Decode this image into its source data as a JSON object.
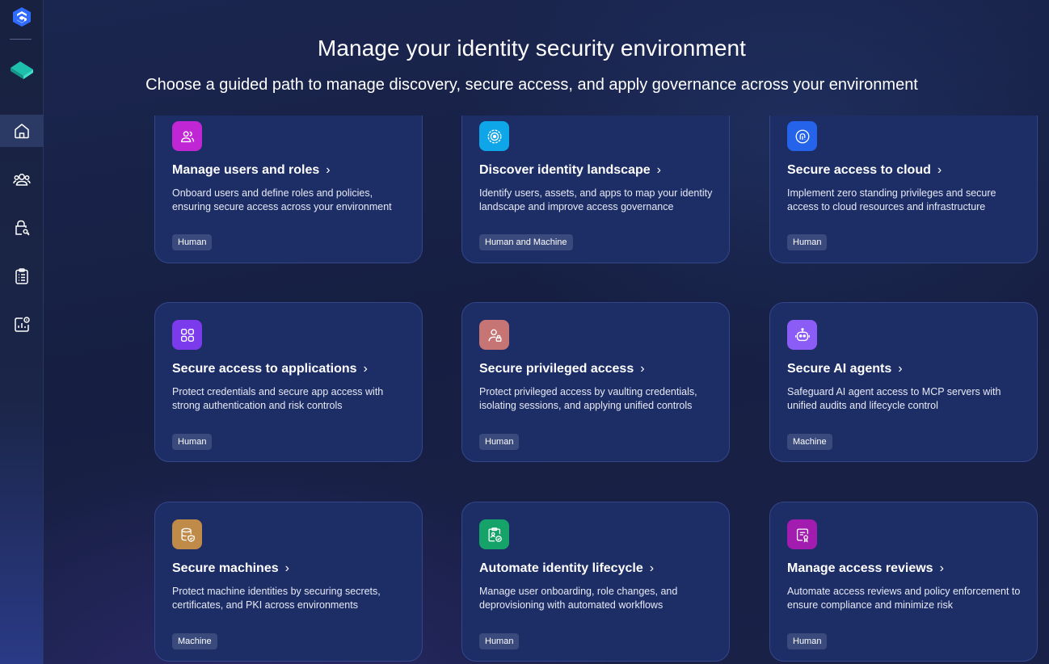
{
  "header": {
    "title": "Manage your identity security environment",
    "subtitle": "Choose a guided path to manage discovery, secure access, and apply governance across your environment"
  },
  "sidebar": {
    "items": [
      {
        "name": "home",
        "icon": "home-icon",
        "active": true
      },
      {
        "name": "users",
        "icon": "users-icon",
        "active": false
      },
      {
        "name": "access",
        "icon": "lock-key-icon",
        "active": false
      },
      {
        "name": "reports",
        "icon": "clipboard-list-icon",
        "active": false
      },
      {
        "name": "analytics",
        "icon": "analytics-icon",
        "active": false
      }
    ]
  },
  "cards": [
    {
      "title": "Manage users and roles",
      "description": "Onboard users and define roles and policies, ensuring secure access across your environment",
      "tag": "Human",
      "icon": "users-icon",
      "icon_color": "#c026d3"
    },
    {
      "title": "Discover identity landscape",
      "description": "Identify users, assets, and apps to map your identity landscape and improve access governance",
      "tag": "Human and Machine",
      "icon": "target-icon",
      "icon_color": "#0ea5e9"
    },
    {
      "title": "Secure access to cloud",
      "description": "Implement zero standing privileges and secure access to cloud resources and infrastructure",
      "tag": "Human",
      "icon": "fingerprint-icon",
      "icon_color": "#2563eb"
    },
    {
      "title": "Secure access to applications",
      "description": "Protect credentials and secure app access with strong authentication and risk controls",
      "tag": "Human",
      "icon": "apps-grid-icon",
      "icon_color": "#7c3aed"
    },
    {
      "title": "Secure privileged access",
      "description": "Protect privileged access by vaulting credentials, isolating sessions, and applying unified controls",
      "tag": "Human",
      "icon": "user-lock-icon",
      "icon_color": "#c67474"
    },
    {
      "title": "Secure AI agents",
      "description": "Safeguard AI agent access to MCP servers with unified audits and lifecycle control",
      "tag": "Machine",
      "icon": "robot-icon",
      "icon_color": "#8b5cf6"
    },
    {
      "title": "Secure machines",
      "description": "Protect machine identities by securing secrets, certificates, and PKI across environments",
      "tag": "Machine",
      "icon": "database-shield-icon",
      "icon_color": "#c08a48"
    },
    {
      "title": "Automate identity lifecycle",
      "description": "Manage user onboarding, role changes, and deprovisioning with automated workflows",
      "tag": "Human",
      "icon": "clipboard-check-icon",
      "icon_color": "#16a36a"
    },
    {
      "title": "Manage access reviews",
      "description": "Automate access reviews and policy enforcement to ensure compliance and minimize risk",
      "tag": "Human",
      "icon": "certificate-icon",
      "icon_color": "#a21caf"
    }
  ]
}
